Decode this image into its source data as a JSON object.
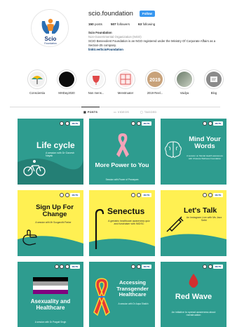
{
  "profile": {
    "username": "scio.foundation",
    "follow_label": "Follow",
    "posts_count": "150",
    "posts_label": "posts",
    "followers_count": "507",
    "followers_label": "followers",
    "following_count": "63",
    "following_label": "following",
    "avatar_text": "Scio",
    "avatar_subtext": "Foundation",
    "bio_name": "Scio Foundation",
    "bio_category": "Non-Governmental Organization (NGO)",
    "bio_text": "SCIO Benevolent Foundation is an NGO registered under the Ministry Of Corporate Affairs as a Section-25 company.",
    "bio_link": "linktr.ee/ScioFoundation"
  },
  "highlights": [
    {
      "label": "Conscientia",
      "icon": "umbrella-icon"
    },
    {
      "label": "MHDay2020",
      "icon": "dark-circle"
    },
    {
      "label": "Non mens...",
      "icon": "menstrual-cup-icon"
    },
    {
      "label": "Menstruater",
      "icon": "grid-icon"
    },
    {
      "label": "2019 Reel...",
      "icon": "2019-badge"
    },
    {
      "label": "Vaidya",
      "icon": "photo"
    },
    {
      "label": "Blog",
      "icon": "blog-icon"
    }
  ],
  "tabs": [
    {
      "label": "POSTS",
      "active": true
    },
    {
      "label": "VIDEOS",
      "active": false
    },
    {
      "label": "TAGGED",
      "active": false
    }
  ],
  "posts": [
    {
      "title": "Life cycle",
      "subtitle": "A session with Dr Ganesh Nayak",
      "theme": "teal",
      "icon": "bicycle-icon"
    },
    {
      "title": "More Power to You",
      "subtitle": "Session with Power of Pranayam",
      "theme": "teal",
      "icon": "pink-ribbon-icon"
    },
    {
      "title": "Mind Your Words",
      "subtitle": "A session on Mental Health awareness with Chetana Wellness Foundation",
      "theme": "teal",
      "icon": "brain-icon"
    },
    {
      "title": "Sign Up For Change",
      "subtitle": "A session with Mr Sougandhi Parker",
      "theme": "yellow",
      "icon": "hand-signing-icon"
    },
    {
      "title": "Senectus",
      "subtitle": "A geriatric healthcare awareness quiz and fundraiser with IMDSC",
      "theme": "yellow",
      "icon": "walking-cane-icon"
    },
    {
      "title": "Let's Talk",
      "subtitle": "An Instagram Live with Ms Jazz Sethi",
      "theme": "yellow",
      "icon": "syringe-icon"
    },
    {
      "title": "Asexuality and Healthcare",
      "subtitle": "A session with Dr Pragati Singh",
      "theme": "teal",
      "icon": "asexual-flag-icon"
    },
    {
      "title": "Accessing Transgender Healthcare",
      "subtitle": "A session with Dr Aqsa Shaikh",
      "theme": "teal",
      "icon": "rainbow-ribbon-icon"
    },
    {
      "title": "Red Wave",
      "subtitle": "An initiative to spread awareness about menstruation",
      "theme": "teal",
      "icon": "blood-drop-icon"
    }
  ],
  "post_logos": {
    "tag_label": "MHTN"
  }
}
